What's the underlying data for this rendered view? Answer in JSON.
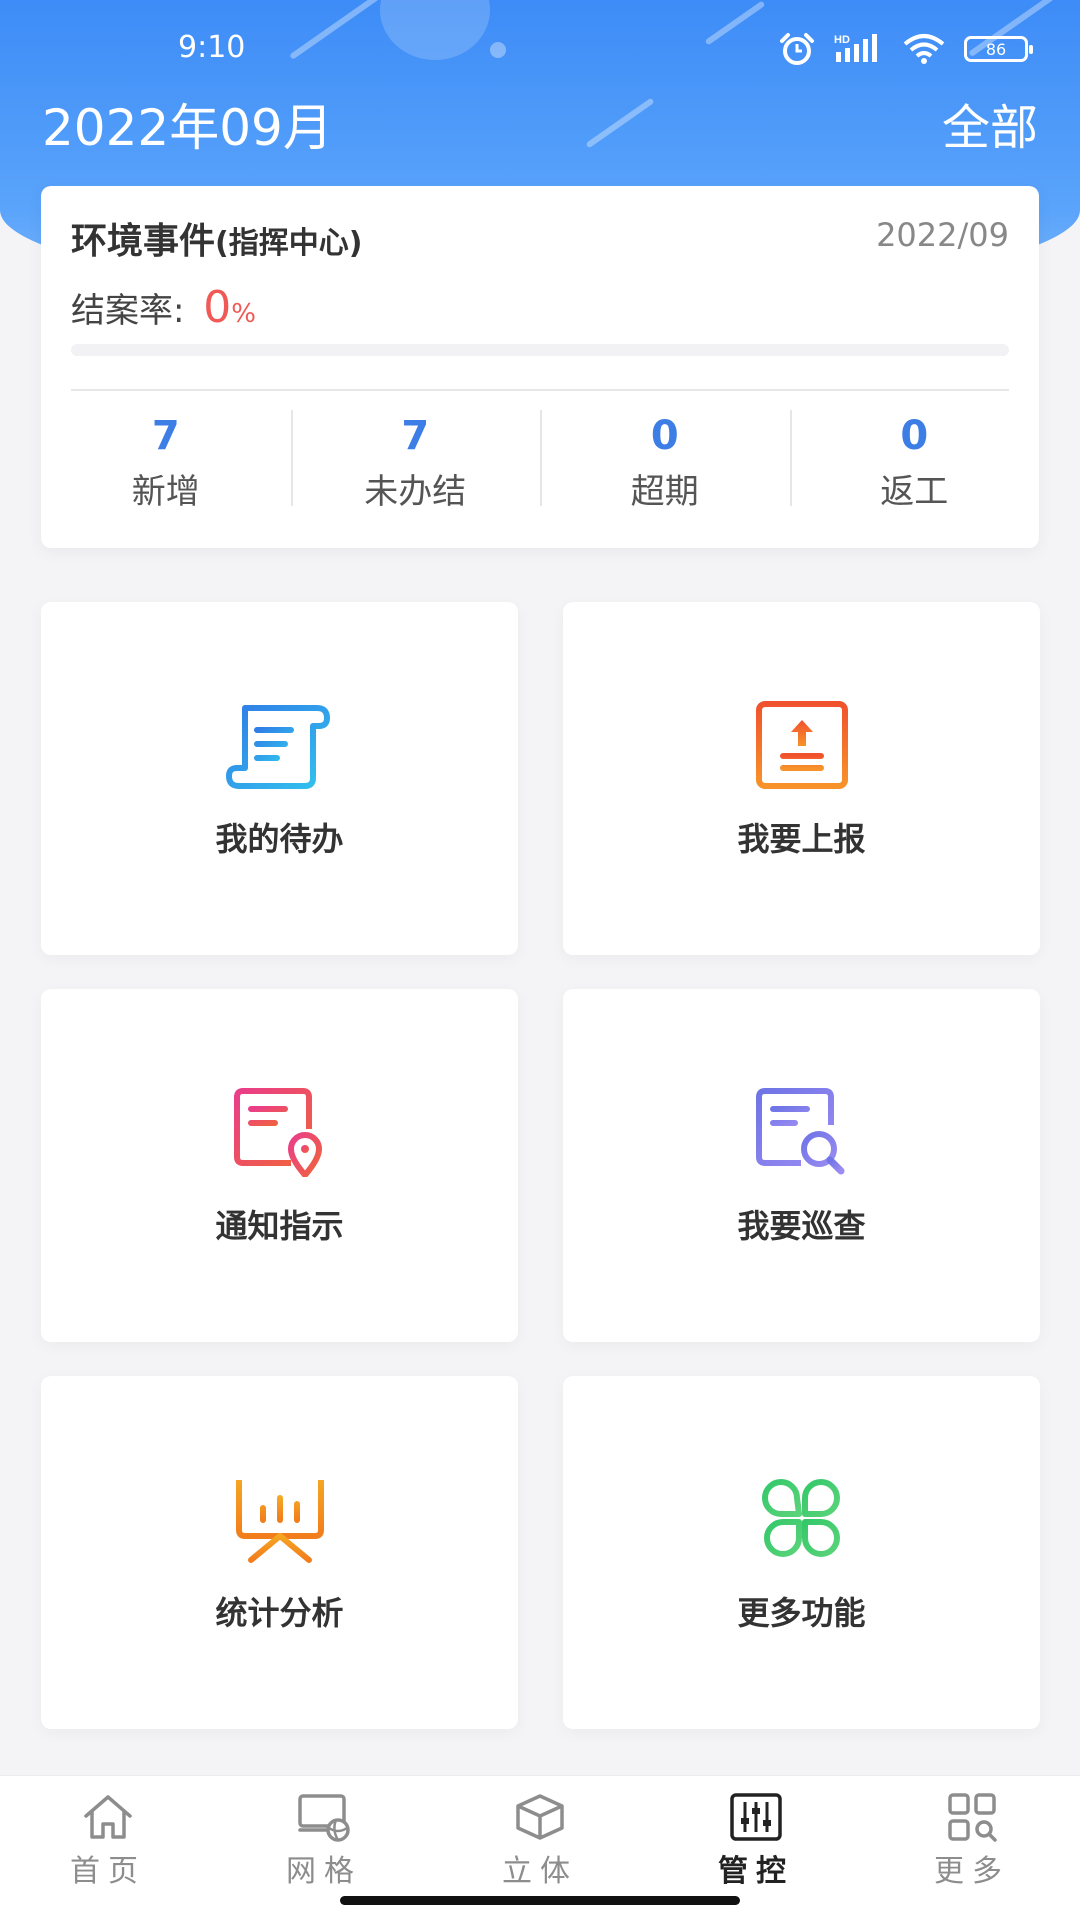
{
  "status_bar": {
    "time": "9:10",
    "network": "HD",
    "battery": "86"
  },
  "header": {
    "date": "2022年09月",
    "filter_label": "全部"
  },
  "summary": {
    "title": "环境事件",
    "subtitle": "(指挥中心)",
    "period": "2022/09",
    "rate_label": "结案率:",
    "rate_value": "0",
    "rate_unit": "%",
    "rate_fraction": 0,
    "stats": [
      {
        "value": "7",
        "label": "新增"
      },
      {
        "value": "7",
        "label": "未办结"
      },
      {
        "value": "0",
        "label": "超期"
      },
      {
        "value": "0",
        "label": "返工"
      }
    ]
  },
  "tiles": [
    {
      "label": "我的待办",
      "icon": "todo-scroll-icon",
      "color": "#3a8ee8"
    },
    {
      "label": "我要上报",
      "icon": "upload-report-icon",
      "color": "#f26a2a"
    },
    {
      "label": "通知指示",
      "icon": "notice-location-icon",
      "color": "#ec3c7a"
    },
    {
      "label": "我要巡查",
      "icon": "inspect-search-icon",
      "color": "#7b72e0"
    },
    {
      "label": "统计分析",
      "icon": "statistics-board-icon",
      "color": "#f3a21b"
    },
    {
      "label": "更多功能",
      "icon": "more-clover-icon",
      "color": "#3fc86a"
    }
  ],
  "bottom_nav": [
    {
      "label": "首页",
      "icon": "home-icon",
      "active": false
    },
    {
      "label": "网格",
      "icon": "grid-globe-icon",
      "active": false
    },
    {
      "label": "立体",
      "icon": "cube-icon",
      "active": false
    },
    {
      "label": "管控",
      "icon": "control-sliders-icon",
      "active": true
    },
    {
      "label": "更多",
      "icon": "more-apps-icon",
      "active": false
    }
  ]
}
